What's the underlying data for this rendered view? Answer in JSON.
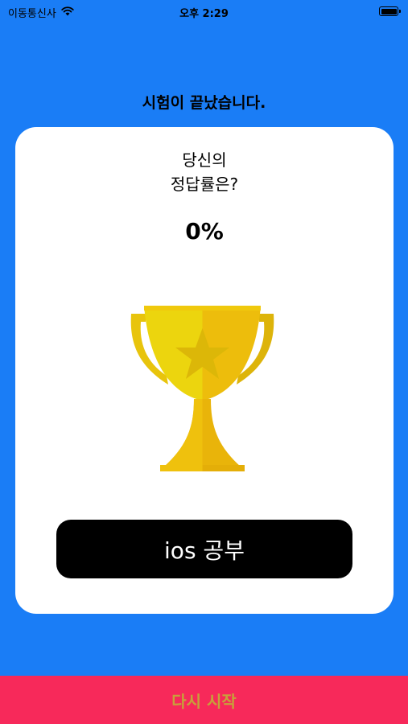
{
  "status_bar": {
    "carrier": "이동통신사",
    "time": "오후 2:29",
    "wifi_icon": "wifi-icon",
    "battery_icon": "battery-icon"
  },
  "heading": "시험이 끝났습니다.",
  "card": {
    "question": "당신의\n정답률은?",
    "rate": "0%",
    "trophy_icon": "trophy-icon",
    "subject_button_label": "ios 공부"
  },
  "restart_label": "다시 시작",
  "colors": {
    "background": "#1a7df6",
    "card": "#ffffff",
    "subject_button": "#000000",
    "restart_button": "#f7295a",
    "restart_text": "#c7a13a",
    "trophy_gold": "#f2c40f"
  }
}
